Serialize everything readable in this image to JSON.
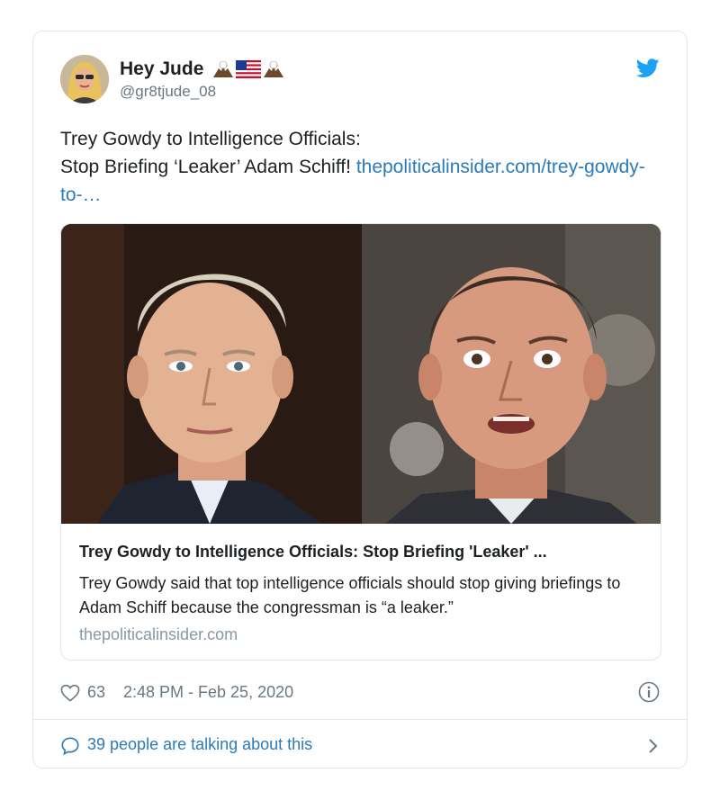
{
  "author": {
    "name": "Hey Jude",
    "name_emojis": [
      "eagle-icon",
      "us-flag-icon",
      "eagle-icon"
    ],
    "handle": "@gr8tjude_08"
  },
  "tweet": {
    "line1": "Trey Gowdy to Intelligence Officials:",
    "line2": "Stop Briefing ‘Leaker’ Adam Schiff!",
    "link_text": "thepoliticalinsider.com/trey-gowdy-to-…"
  },
  "link_card": {
    "title": "Trey Gowdy to Intelligence Officials: Stop Briefing 'Leaker' ...",
    "description": "Trey Gowdy said that top intelligence officials should stop giving briefings to Adam Schiff because the congressman is “a leaker.”",
    "domain": "thepoliticalinsider.com",
    "image_icon": "photo-two-men"
  },
  "footer": {
    "likes": "63",
    "timestamp": "2:48 PM - Feb 25, 2020"
  },
  "talking": {
    "text": "39 people are talking about this"
  },
  "colors": {
    "link": "#2b7bb9",
    "twitter_blue": "#1da1f2",
    "muted": "#697882",
    "border": "#e1e8ed"
  }
}
